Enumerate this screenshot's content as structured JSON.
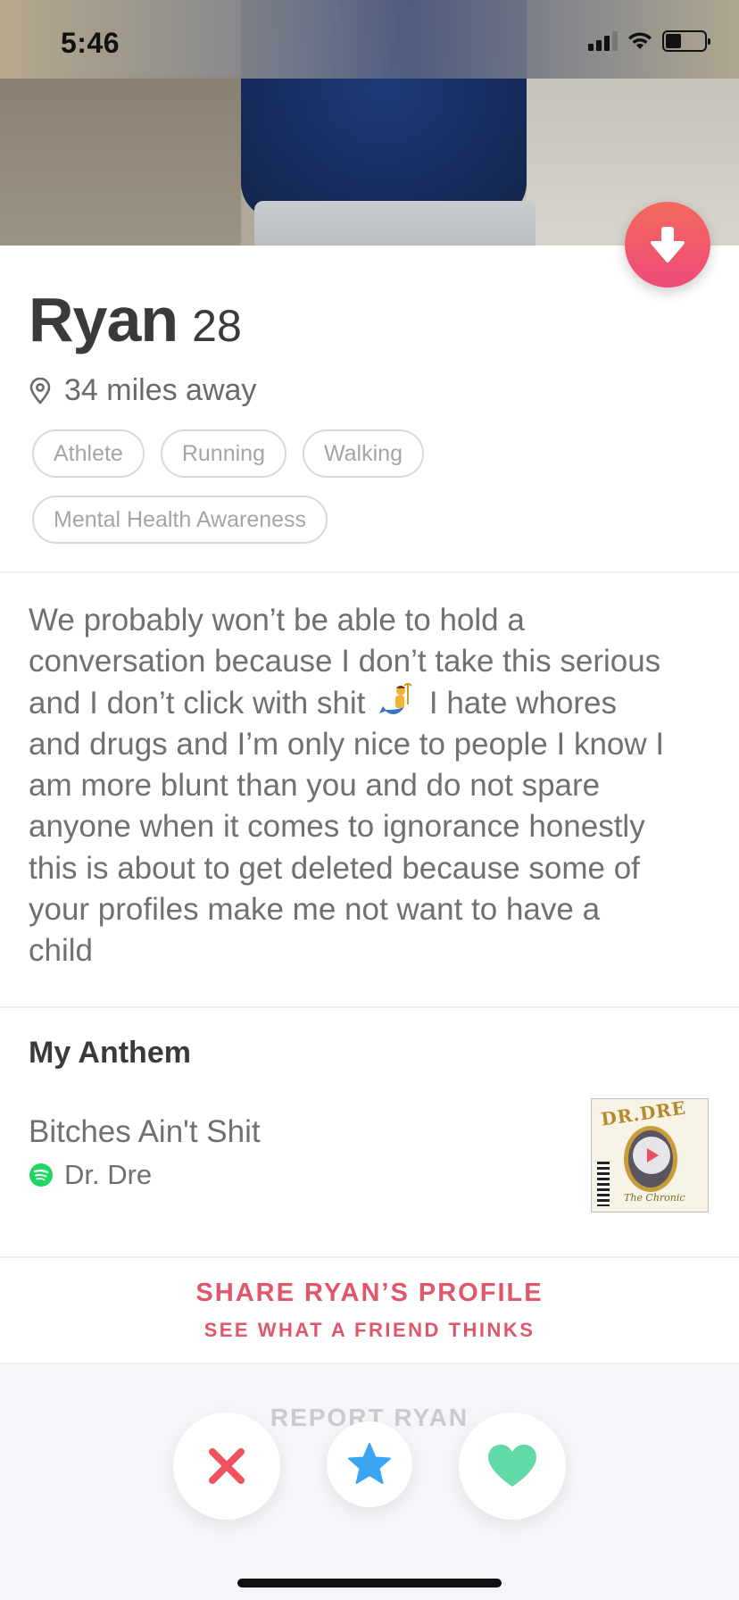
{
  "status_bar": {
    "time": "5:46",
    "battery_level": 0.4
  },
  "profile": {
    "name": "Ryan",
    "age": "28",
    "distance": "34 miles away",
    "interests": [
      "Athlete",
      "Running",
      "Walking",
      "Mental Health Awareness"
    ],
    "bio_lines": [
      "We probably won’t be able to hold a",
      "conversation because I don’t take this serious",
      "and I don’t click with shit",
      "I hate whores",
      "and drugs and I’m only nice to people I know I",
      "am more blunt than you and do not spare",
      "anyone when it comes to ignorance honestly",
      "this is about to get deleted because some of",
      "your profiles make me not want to have a",
      "child"
    ]
  },
  "anthem": {
    "title": "My Anthem",
    "song": "Bitches Ain't Shit",
    "artist": "Dr. Dre",
    "album_text_top": "DR.DRE",
    "album_text_bottom": "The Chronic"
  },
  "share": {
    "label": "SHARE RYAN’S PROFILE",
    "sublabel": "SEE WHAT A FRIEND THINKS"
  },
  "report": {
    "label": "REPORT RYAN"
  },
  "icons": {
    "collapse": "arrow-down-icon",
    "location": "location-pin-icon",
    "music_service": "spotify-icon",
    "nope": "close-icon",
    "super_like": "star-icon",
    "like": "heart-icon"
  },
  "colors": {
    "accent_gradient_start": "#f46a5d",
    "accent_gradient_end": "#ee4a78",
    "nope": "#f0535e",
    "super_like": "#3aa5f0",
    "like": "#62d9a9",
    "spotify": "#1ed760"
  }
}
